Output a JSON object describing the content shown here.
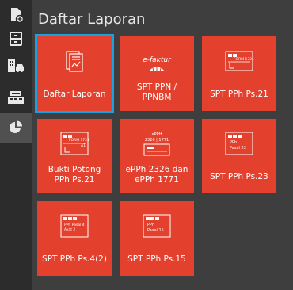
{
  "page_title": "Daftar Laporan",
  "colors": {
    "tile": "#e3402e",
    "selected_border": "#1ba1e2",
    "sidebar": "#2c2c2c",
    "background": "#3e3e3e"
  },
  "sidebar": {
    "items": [
      {
        "icon": "document-add-icon"
      },
      {
        "icon": "archive-cabinet-icon"
      },
      {
        "icon": "building-car-icon"
      },
      {
        "icon": "cash-register-icon"
      },
      {
        "icon": "pie-chart-icon",
        "active": true
      }
    ]
  },
  "tiles": [
    {
      "label": "Daftar Laporan",
      "icon": "report-document-icon",
      "selected": true
    },
    {
      "label": "SPT PPN /\nPPNBM",
      "icon": "efaktur-icon",
      "icon_text": "e-faktur"
    },
    {
      "label": "SPT PPh Ps.21",
      "icon": "form-1721-icon",
      "icon_text": "FORM 1721"
    },
    {
      "label": "Bukti Potong\nPPh Ps.21",
      "icon": "form-1721-a1-icon",
      "icon_text": "FORM 1721",
      "icon_subtext": "A1"
    },
    {
      "label": "ePPh 2326 dan\nePPh 1771",
      "icon": "epph-icon",
      "icon_text": "ePPH",
      "icon_subtext": "2326 | 1771"
    },
    {
      "label": "SPT PPh Ps.23",
      "icon": "pph-pasal-23-icon",
      "icon_text": "PPh",
      "icon_subtext": "Pasal 23"
    },
    {
      "label": "SPT PPh Ps.4(2)",
      "icon": "pph-pasal-4-ayat-2-icon",
      "icon_text": "PPh Pasal 4",
      "icon_subtext": "Ayat 2"
    },
    {
      "label": "SPT PPh Ps.15",
      "icon": "pph-pasal-15-icon",
      "icon_text": "PPh",
      "icon_subtext": "Pasal 15"
    }
  ]
}
